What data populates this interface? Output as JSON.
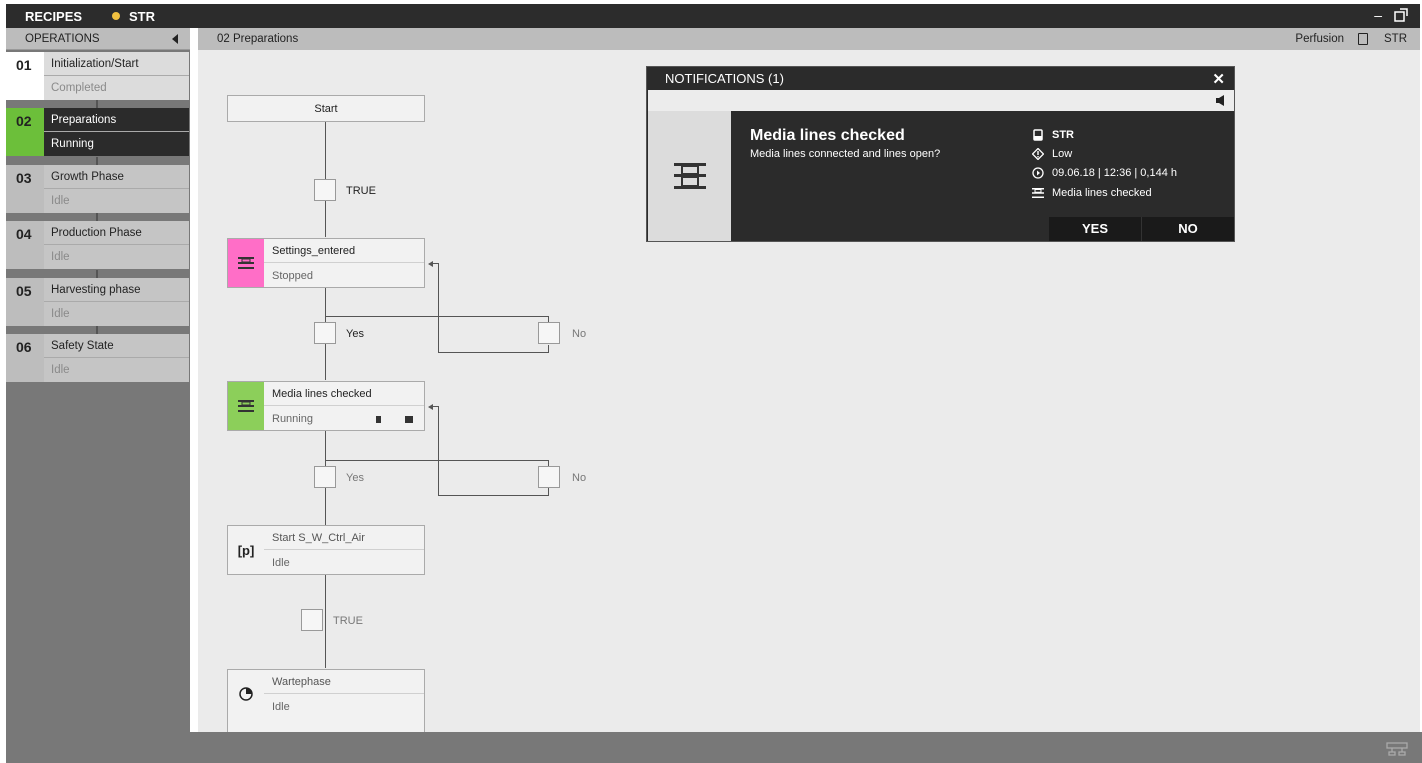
{
  "titlebar": {
    "title": "RECIPES",
    "device": "STR"
  },
  "operations": {
    "header": "OPERATIONS",
    "items": [
      {
        "num": "01",
        "name": "Initialization/Start",
        "state": "Completed"
      },
      {
        "num": "02",
        "name": "Preparations",
        "state": "Running"
      },
      {
        "num": "03",
        "name": "Growth Phase",
        "state": "Idle"
      },
      {
        "num": "04",
        "name": "Production Phase",
        "state": "Idle"
      },
      {
        "num": "05",
        "name": "Harvesting phase",
        "state": "Idle"
      },
      {
        "num": "06",
        "name": "Safety State",
        "state": "Idle"
      }
    ]
  },
  "main": {
    "title": "02 Preparations",
    "mode": "Perfusion",
    "device": "STR"
  },
  "flow": {
    "start": "Start",
    "cond1": "TRUE",
    "node1": {
      "title": "Settings_entered",
      "state": "Stopped"
    },
    "cond2_yes": "Yes",
    "cond2_no": "No",
    "node2": {
      "title": "Media lines checked",
      "state": "Running"
    },
    "cond3_yes": "Yes",
    "cond3_no": "No",
    "node3": {
      "title": "Start S_W_Ctrl_Air",
      "state": "Idle",
      "icon_text": "[p]"
    },
    "cond4": "TRUE",
    "node4": {
      "title": "Wartephase",
      "state": "Idle"
    }
  },
  "notification": {
    "title": "NOTIFICATIONS (1)",
    "heading": "Media lines checked",
    "text": "Media lines connected and lines open?",
    "device": "STR",
    "priority": "Low",
    "time": "09.06.18 | 12:36 | 0,144 h",
    "step": "Media lines checked",
    "yes_label": "YES",
    "no_label": "NO"
  },
  "colors": {
    "active": "#6cbf3a",
    "stopped": "#ff6ec7",
    "running": "#8ccf5a",
    "status_dot": "#f0c040"
  }
}
